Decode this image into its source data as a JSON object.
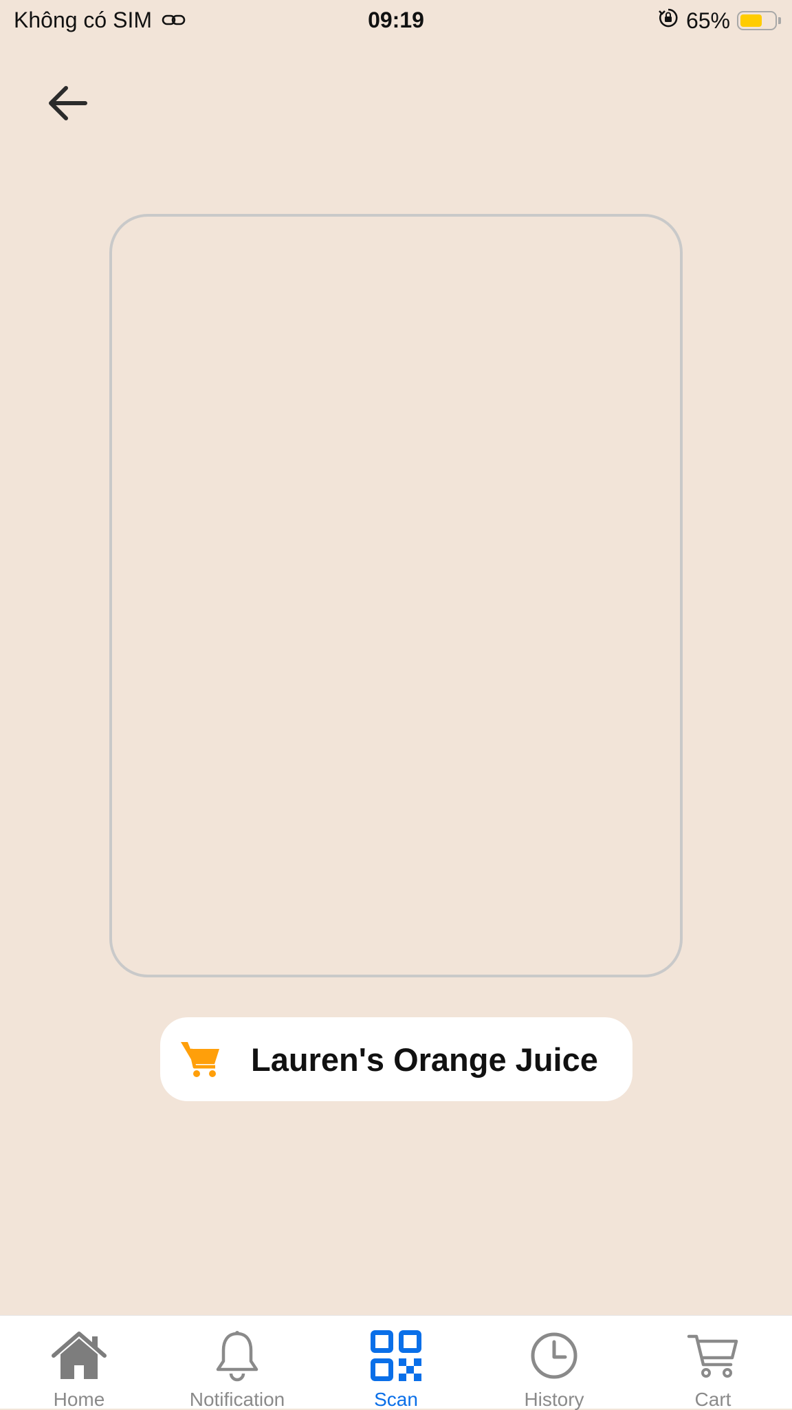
{
  "status_bar": {
    "carrier": "Không có SIM",
    "time": "09:19",
    "battery_percent": "65%",
    "battery_level": 0.65,
    "battery_color": "#ffcc00",
    "icons": [
      "link-icon",
      "orientation-lock-icon",
      "battery-icon"
    ]
  },
  "header": {
    "back_icon": "arrow-left-icon"
  },
  "scanner": {
    "frame_color": "#c9c9c9"
  },
  "product": {
    "name": "Lauren's Orange Juice",
    "icon": "cart-icon",
    "icon_color": "#ff9f0a"
  },
  "tabbar": {
    "active_color": "#0a6fe8",
    "inactive_color": "#8a8a8a",
    "tabs": [
      {
        "label": "Home",
        "icon": "home-icon",
        "active": false
      },
      {
        "label": "Notification",
        "icon": "bell-icon",
        "active": false
      },
      {
        "label": "Scan",
        "icon": "qr-code-icon",
        "active": true
      },
      {
        "label": "History",
        "icon": "clock-icon",
        "active": false
      },
      {
        "label": "Cart",
        "icon": "cart-icon",
        "active": false
      }
    ]
  }
}
